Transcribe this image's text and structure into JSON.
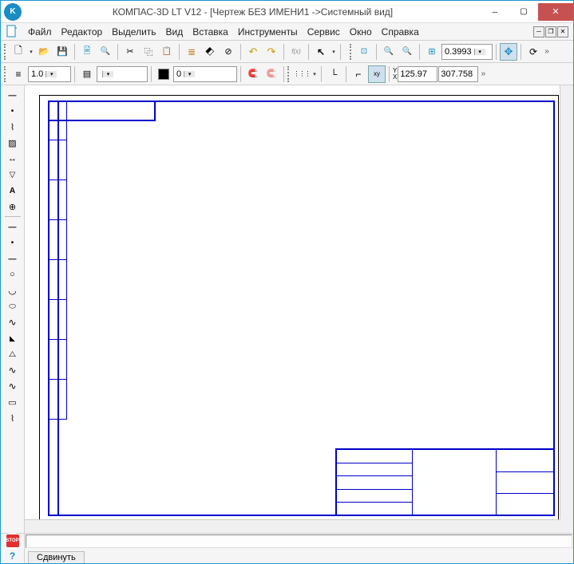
{
  "titlebar": {
    "title": "КОМПАС-3D LT V12 - [Чертеж БЕЗ ИМЕНИ1 ->Системный вид]"
  },
  "menu": {
    "file": "Файл",
    "edit": "Редактор",
    "select": "Выделить",
    "view": "Вид",
    "insert": "Вставка",
    "tools": "Инструменты",
    "service": "Сервис",
    "window": "Окно",
    "help": "Справка"
  },
  "toolbar1": {
    "zoom_value": "0.3993"
  },
  "toolbar2": {
    "line_style_value": "1.0",
    "layer_value": "",
    "color_value": "0",
    "coord_x": "125.97",
    "coord_y": "307.758",
    "yx_label_y": "Y",
    "yx_label_x": "X"
  },
  "bottom": {
    "stop_label": "STOP",
    "tab_shift": "Сдвинуть"
  }
}
